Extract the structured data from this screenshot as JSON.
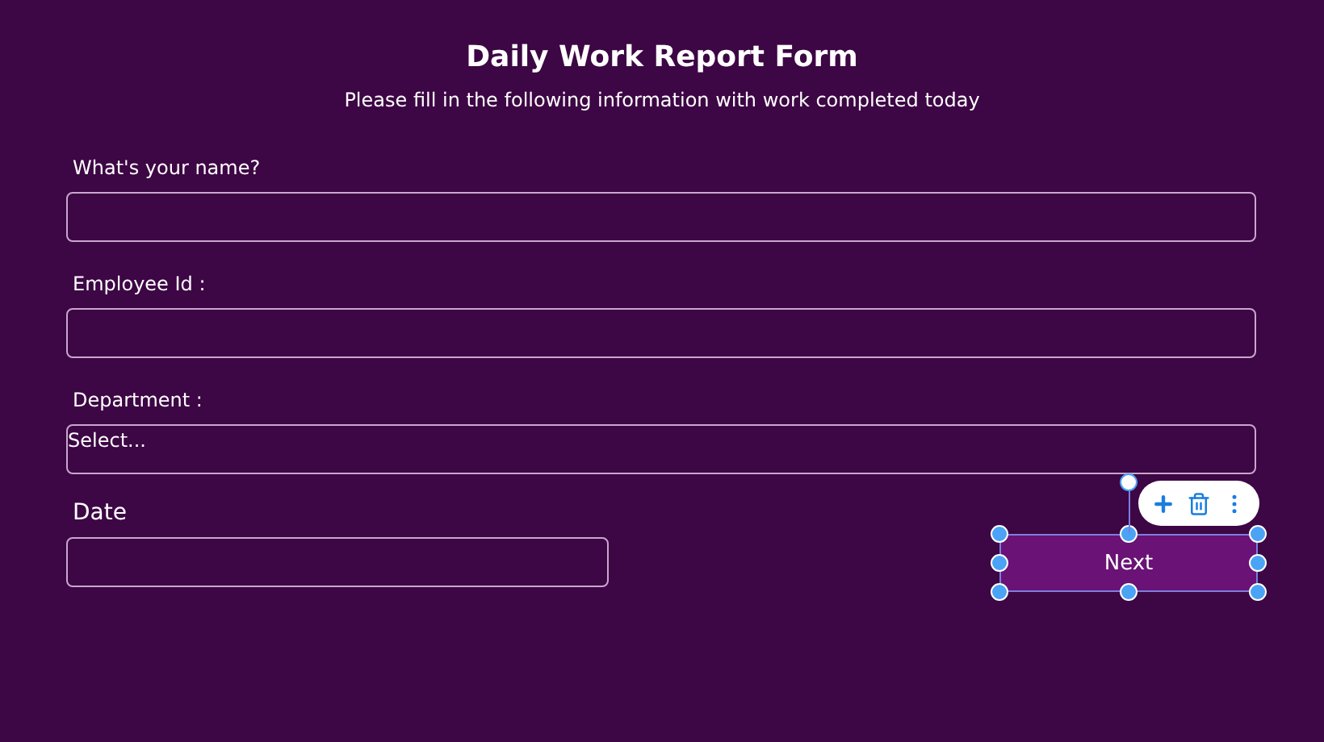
{
  "title": "Daily Work Report Form",
  "subtitle": "Please fill in the following information with work completed today",
  "fields": [
    {
      "kind": "text",
      "label": "What's your name?"
    },
    {
      "kind": "text",
      "label": "Employee Id :"
    },
    {
      "kind": "select",
      "label": "Department :",
      "value": "Select..."
    }
  ],
  "date_field": {
    "label": "Date"
  },
  "next_button": {
    "label": "Next",
    "selected": true
  }
}
